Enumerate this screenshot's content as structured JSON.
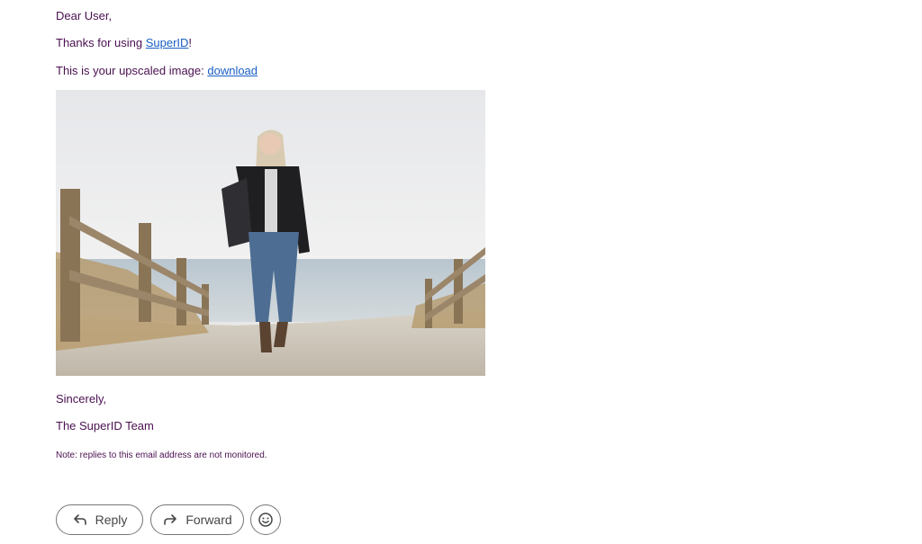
{
  "email": {
    "greeting": "Dear User,",
    "thanks_prefix": "Thanks for using ",
    "thanks_link": "SuperID",
    "thanks_suffix": "!",
    "upscaled_prefix": "This is your upscaled image: ",
    "download_link": "download",
    "closing": "Sincerely,",
    "signature": "The SuperID Team",
    "note": "Note: replies to this email address are not monitored."
  },
  "actions": {
    "reply_label": "Reply",
    "forward_label": "Forward",
    "reply_icon": "reply-arrow-icon",
    "forward_icon": "forward-arrow-icon",
    "emoji_icon": "smiley-face-icon"
  },
  "colors": {
    "body_text": "#4a1050",
    "link": "#1a5fc4",
    "button_border": "#747775"
  }
}
